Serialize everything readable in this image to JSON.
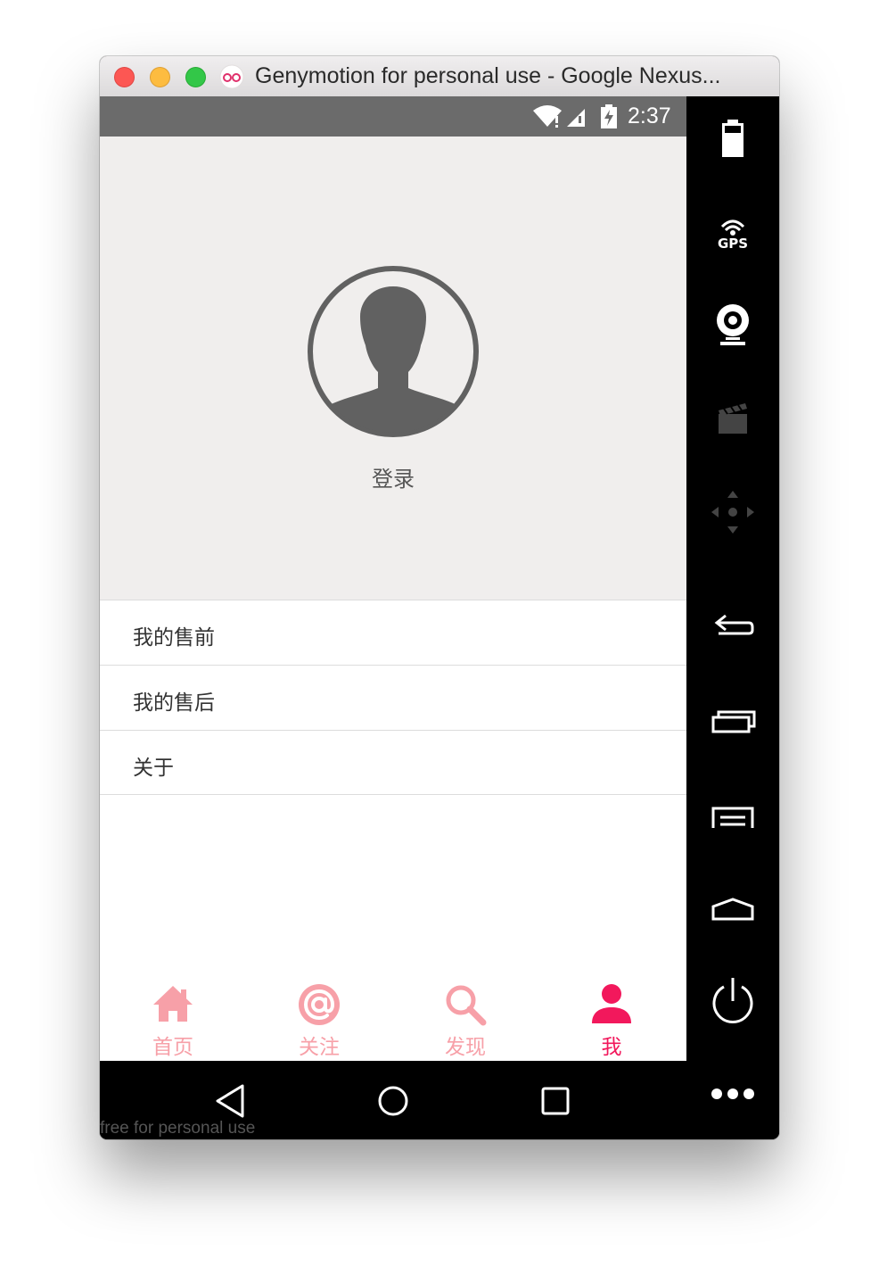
{
  "window": {
    "title": "Genymotion for personal use - Google Nexus..."
  },
  "status_bar": {
    "time": "2:37"
  },
  "profile": {
    "login_label": "登录"
  },
  "menu": {
    "items": [
      {
        "label": "我的售前"
      },
      {
        "label": "我的售后"
      },
      {
        "label": "关于"
      }
    ]
  },
  "tabs": [
    {
      "label": "首页",
      "icon": "home-icon",
      "active": false
    },
    {
      "label": "关注",
      "icon": "at-icon",
      "active": false
    },
    {
      "label": "发现",
      "icon": "search-icon",
      "active": false
    },
    {
      "label": "我",
      "icon": "person-icon",
      "active": true
    }
  ],
  "sidebar": {
    "gps_label": "GPS"
  },
  "footer": {
    "text": "free for personal use"
  },
  "colors": {
    "tab_inactive": "#f7a0a8",
    "tab_active": "#f2185c",
    "header_bg": "#f0eeed",
    "status_bar_bg": "#6b6b6b"
  }
}
